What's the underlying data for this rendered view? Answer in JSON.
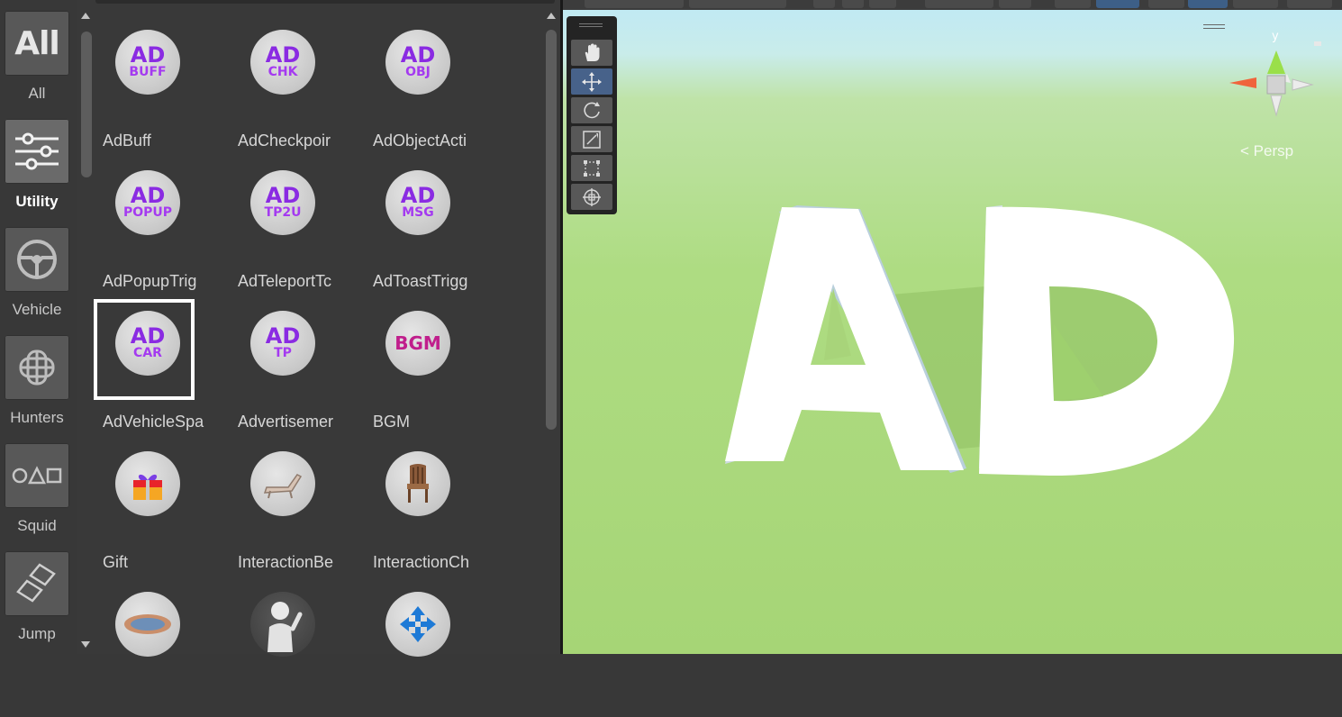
{
  "categories": [
    {
      "label": "All",
      "tile_text": "All",
      "icon": "all-icon"
    },
    {
      "label": "Utility",
      "icon": "sliders-icon",
      "active": true
    },
    {
      "label": "Vehicle",
      "icon": "steering-wheel-icon"
    },
    {
      "label": "Hunters",
      "icon": "globe-icon"
    },
    {
      "label": "Squid",
      "icon": "shapes-icon"
    },
    {
      "label": "Jump",
      "icon": "blocks-icon"
    }
  ],
  "assets": [
    {
      "label": "AdBuff",
      "icon_main": "AD",
      "icon_sub": "BUFF"
    },
    {
      "label": "AdCheckpoir",
      "icon_main": "AD",
      "icon_sub": "CHK"
    },
    {
      "label": "AdObjectActi",
      "icon_main": "AD",
      "icon_sub": "OBJ"
    },
    {
      "label": "AdPopupTrig",
      "icon_main": "AD",
      "icon_sub": "POPUP"
    },
    {
      "label": "AdTeleportTc",
      "icon_main": "AD",
      "icon_sub": "TP2U"
    },
    {
      "label": "AdToastTrigg",
      "icon_main": "AD",
      "icon_sub": "MSG"
    },
    {
      "label": "AdVehicleSpa",
      "icon_main": "AD",
      "icon_sub": "CAR",
      "selected": true
    },
    {
      "label": "Advertisemer",
      "icon_main": "AD",
      "icon_sub": "TP"
    },
    {
      "label": "BGM",
      "icon_main": "BGM"
    },
    {
      "label": "Gift",
      "icon": "gift-icon"
    },
    {
      "label": "InteractionBe",
      "icon": "lounge-chair-icon"
    },
    {
      "label": "InteractionCh",
      "icon": "chair-icon"
    },
    {
      "label": "",
      "icon": "trampoline-icon"
    },
    {
      "label": "",
      "icon": "avatar-wave-icon"
    },
    {
      "label": "",
      "icon": "move-arrows-icon"
    }
  ],
  "scene": {
    "projection_label": "< Persp",
    "gizmo_axis_label": "y",
    "model_text": "AD",
    "tools": [
      {
        "name": "hand-tool",
        "icon": "hand-icon"
      },
      {
        "name": "move-tool",
        "icon": "move-icon",
        "active": true
      },
      {
        "name": "rotate-tool",
        "icon": "rotate-icon"
      },
      {
        "name": "scale-tool",
        "icon": "scale-icon"
      },
      {
        "name": "rect-tool",
        "icon": "rect-transform-icon"
      },
      {
        "name": "transform-tool",
        "icon": "transform-icon"
      }
    ],
    "colors": {
      "sky": "#bfe9f5",
      "ground": "#a6d576",
      "toolbar_active": "#3d5f87",
      "selection": "#ffffff",
      "ad_purple": "#8a2be2",
      "bgm_magenta": "#c01e8c"
    }
  }
}
